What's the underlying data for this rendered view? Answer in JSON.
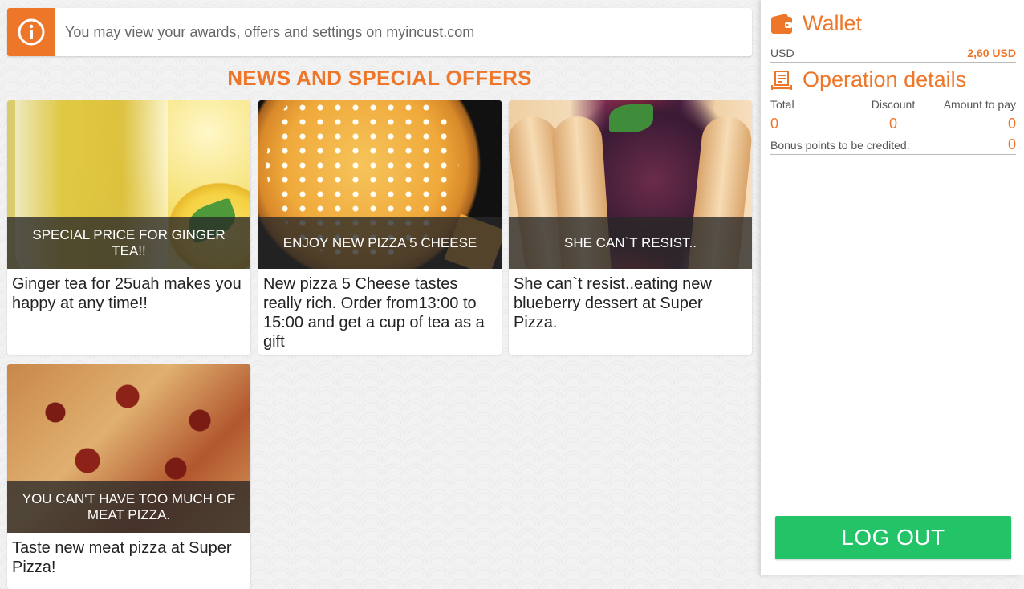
{
  "banner": {
    "icon": "info-icon",
    "text": "You may view your awards, offers and settings on myincust.com"
  },
  "section_title": "NEWS AND SPECIAL OFFERS",
  "offers": [
    {
      "caption": "SPECIAL PRICE FOR GINGER TEA!!",
      "text": "Ginger tea for 25uah makes you happy  at any time!!"
    },
    {
      "caption": "ENJOY NEW PIZZA 5 CHEESE",
      "text": "New pizza 5 Cheese tastes really rich. Order from13:00 to 15:00 and get a cup of tea as a gift"
    },
    {
      "caption": "SHE CAN`T RESIST..",
      "text": "She can`t resist..eating new blueberry dessert at  Super Pizza."
    },
    {
      "caption": "YOU CAN'T HAVE TOO MUCH OF MEAT PIZZA.",
      "text": "Taste new meat pizza at Super Pizza!"
    }
  ],
  "wallet": {
    "title": "Wallet",
    "icon": "wallet-icon",
    "currency": "USD",
    "amount": "2,60 USD"
  },
  "operation": {
    "title": "Operation details",
    "icon": "receipt-icon",
    "labels": [
      "Total",
      "Discount",
      "Amount to pay"
    ],
    "values": [
      "0",
      "0",
      "0"
    ],
    "bonus_label": "Bonus points to be credited:",
    "bonus_value": "0"
  },
  "logout_label": "LOG OUT",
  "colors": {
    "accent": "#ee7628",
    "logout": "#23c467"
  }
}
